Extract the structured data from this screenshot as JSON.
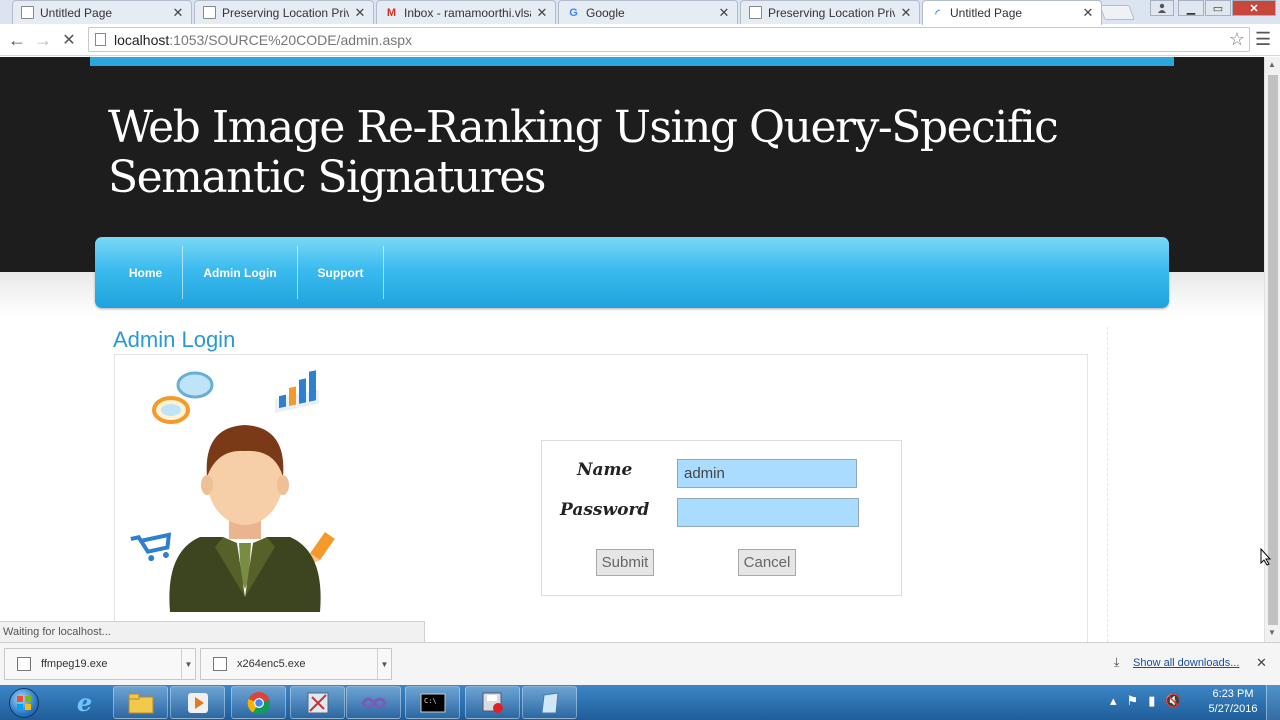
{
  "browser": {
    "tabs": [
      {
        "title": "Untitled Page",
        "icon": "page-icon",
        "active": false
      },
      {
        "title": "Preserving Location Privac",
        "icon": "page-icon",
        "active": false
      },
      {
        "title": "Inbox - ramamoorthi.vlsa",
        "icon": "gmail-icon",
        "active": false
      },
      {
        "title": "Google",
        "icon": "google-icon",
        "active": false
      },
      {
        "title": "Preserving Location Privac",
        "icon": "page-icon",
        "active": false
      },
      {
        "title": "Untitled Page",
        "icon": "loading-icon",
        "active": true
      }
    ],
    "url_host": "localhost",
    "url_path": ":1053/SOURCE%20CODE/admin.aspx",
    "status_text": "Waiting for localhost..."
  },
  "page": {
    "title_line1": "Web Image Re-Ranking Using Query-Specific",
    "title_line2": "Semantic Signatures",
    "nav": [
      {
        "label": "Home"
      },
      {
        "label": "Admin Login"
      },
      {
        "label": "Support"
      }
    ],
    "section_heading": "Admin Login",
    "login": {
      "name_label": "Name",
      "name_value": "admin",
      "password_label": "Password",
      "password_value": "",
      "submit_label": "Submit",
      "cancel_label": "Cancel"
    }
  },
  "downloads": {
    "items": [
      {
        "filename": "ffmpeg19.exe"
      },
      {
        "filename": "x264enc5.exe"
      }
    ],
    "show_all": "Show all downloads..."
  },
  "taskbar": {
    "time": "6:23 PM",
    "date": "5/27/2016"
  },
  "colors": {
    "accent": "#2aa7df",
    "hero_bg": "#1d1d1d",
    "heading": "#2a9ad4",
    "input_bg": "#a9dcff"
  }
}
